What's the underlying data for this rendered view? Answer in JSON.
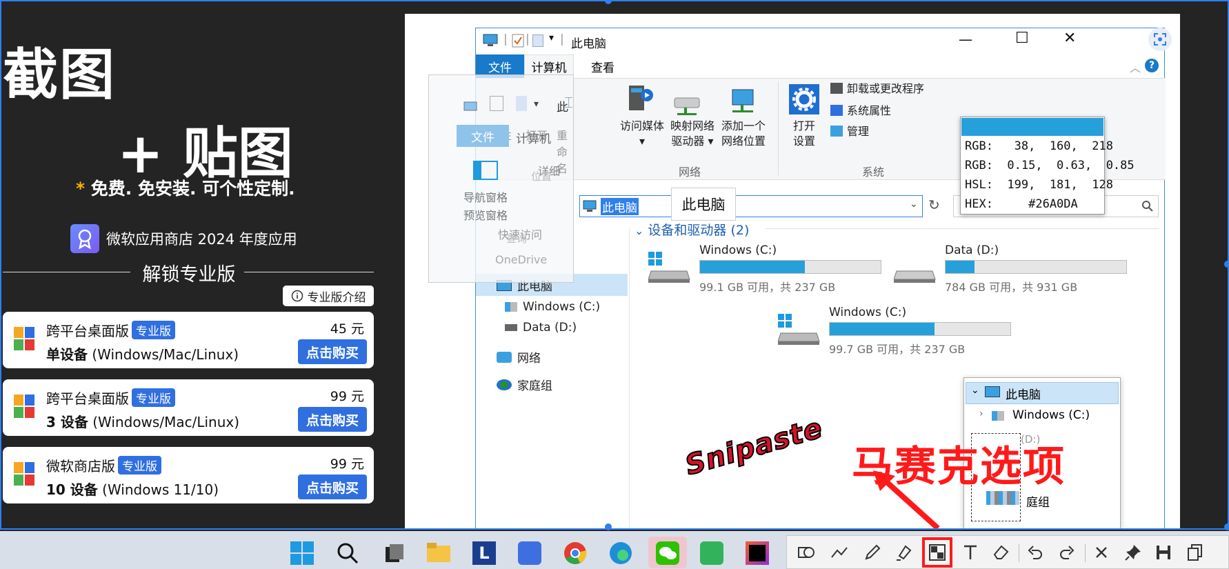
{
  "promo": {
    "title_line1": "截图",
    "title_line2": "+ 贴图",
    "tagline_star": "*",
    "tagline": " 免费. 免安装. 可个性定制.",
    "award": "微软应用商店 2024 年度应用",
    "unlock": "解锁专业版",
    "intro_btn": "专业版介绍",
    "plans": [
      {
        "name": "跨平台桌面版",
        "pro": "专业版",
        "devices_bold": "单设备",
        "devices_rest": " (Windows/Mac/Linux)",
        "price": "45 元",
        "buy": "点击购买"
      },
      {
        "name": "跨平台桌面版",
        "pro": "专业版",
        "devices_bold": "3 设备",
        "devices_rest": " (Windows/Mac/Linux)",
        "price": "99 元",
        "buy": "点击购买"
      },
      {
        "name": "微软商店版",
        "pro": "专业版",
        "devices_bold": "10 设备",
        "devices_rest": " (Windows 11/10)",
        "price": "99 元",
        "buy": "点击购买"
      }
    ]
  },
  "explorer": {
    "title": "此电脑",
    "tabs": [
      "文件",
      "计算机",
      "查看"
    ],
    "ribbon": {
      "access_media": "访问媒体",
      "map_drive_1": "映射网络",
      "map_drive_2": "驱动器",
      "add_location_1": "添加一个",
      "add_location_2": "网络位置",
      "open_settings_1": "打开",
      "open_settings_2": "设置",
      "uninstall": "卸载或更改程序",
      "system_props": "系统属性",
      "manage": "管理",
      "group_network": "网络",
      "group_system": "系统"
    },
    "address": "此电脑",
    "tooltip": "此电脑",
    "section": "设备和驱动器 (2)",
    "nav": {
      "this_pc": "此电脑",
      "windows_c": "Windows (C:)",
      "data_d": "Data (D:)",
      "network": "网络",
      "homegroup": "家庭组"
    },
    "drives": [
      {
        "name": "Windows (C:)",
        "free": "99.1 GB 可用，共 237 GB",
        "used_fraction": 0.58
      },
      {
        "name": "Data (D:)",
        "free": "784 GB 可用，共 931 GB",
        "used_fraction": 0.16
      },
      {
        "name": "Windows (C:)",
        "free": "99.7 GB 可用，共 237 GB",
        "used_fraction": 0.58
      }
    ]
  },
  "ghost_window": {
    "title": "此",
    "tab_file": "文件",
    "tab_computer": "计算机",
    "props": "属性",
    "open": "打开",
    "rename": "重命名",
    "details": "详细",
    "position": "位置",
    "nav_pane": "导航窗格",
    "preview_pane": "预览窗格",
    "quick_access": "快速访问",
    "onedrive": "OneDrive",
    "query": "查询"
  },
  "color_picker": {
    "swatch": "#26A0DA",
    "rgb_int": "RGB:   38,  160,  218",
    "rgb_float": "RGB:  0.15,  0.63,  0.85",
    "hsl": "HSL:  199,  181,  128",
    "hex": "HEX:     #26A0DA"
  },
  "tree_popup": {
    "this_pc": "此电脑",
    "windows_c": "Windows (C:)",
    "partial_1": "(D:)",
    "partial_2": "庭组"
  },
  "annotation": {
    "logo": "Snipaste",
    "mosaic_label": "马赛克选项",
    "color": "#ff1a1a"
  },
  "toolbar": {
    "tools": [
      "rectangle-tool-icon",
      "polyline-icon",
      "pencil-icon",
      "marker-icon",
      "mosaic-icon",
      "text-icon",
      "eraser-icon",
      "undo-icon",
      "redo-icon",
      "close-icon",
      "pin-icon",
      "save-icon",
      "copy-icon"
    ]
  },
  "colors": {
    "accent": "#2f7ff0",
    "buy_button": "#2f6fe0",
    "drive_bar": "#26a0da"
  }
}
